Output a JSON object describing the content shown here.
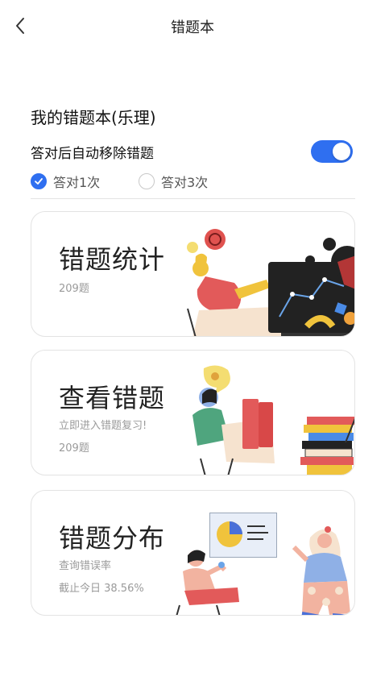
{
  "nav": {
    "title": "错题本"
  },
  "book": {
    "title": "我的错题本(乐理)"
  },
  "settings": {
    "auto_remove_label": "答对后自动移除错题",
    "auto_remove_on": true,
    "options": [
      {
        "label": "答对1次",
        "checked": true
      },
      {
        "label": "答对3次",
        "checked": false
      }
    ]
  },
  "cards": {
    "stats": {
      "title": "错题统计",
      "count": "209题"
    },
    "review": {
      "title": "查看错题",
      "desc": "立即进入错题复习!",
      "count": "209题"
    },
    "distribution": {
      "title": "错题分布",
      "desc": "查询错误率",
      "rate": "截止今日 38.56%"
    }
  },
  "icons": [
    "back-arrow-icon",
    "check-icon"
  ],
  "colors": {
    "accent": "#2f6ff0",
    "card_border": "#e3e3e3",
    "muted_text": "#9a9a9a"
  }
}
